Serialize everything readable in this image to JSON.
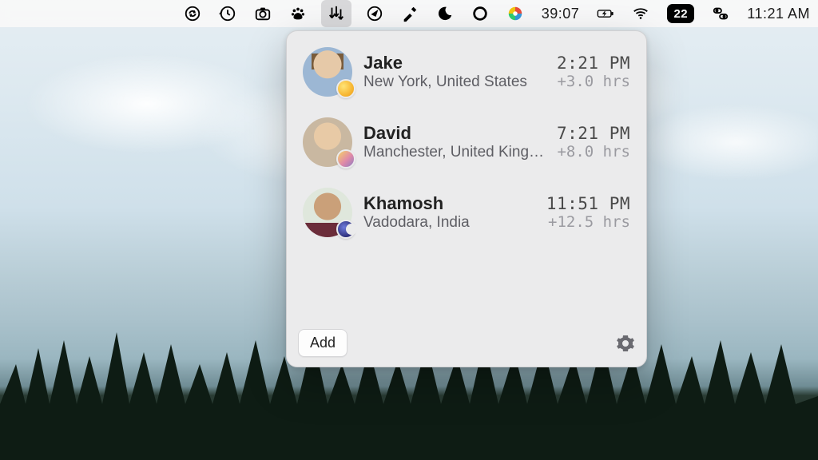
{
  "menubar": {
    "timer": "39:07",
    "date_badge": "22",
    "clock": "11:21 AM"
  },
  "panel": {
    "people": [
      {
        "name": "Jake",
        "location": "New York, United States",
        "time": "2:21 PM",
        "offset": "+3.0 hrs",
        "phase": "sun"
      },
      {
        "name": "David",
        "location": "Manchester, United King…",
        "time": "7:21 PM",
        "offset": "+8.0 hrs",
        "phase": "sunset"
      },
      {
        "name": "Khamosh",
        "location": "Vadodara, India",
        "time": "11:51 PM",
        "offset": "+12.5 hrs",
        "phase": "moon"
      }
    ],
    "add_label": "Add"
  }
}
